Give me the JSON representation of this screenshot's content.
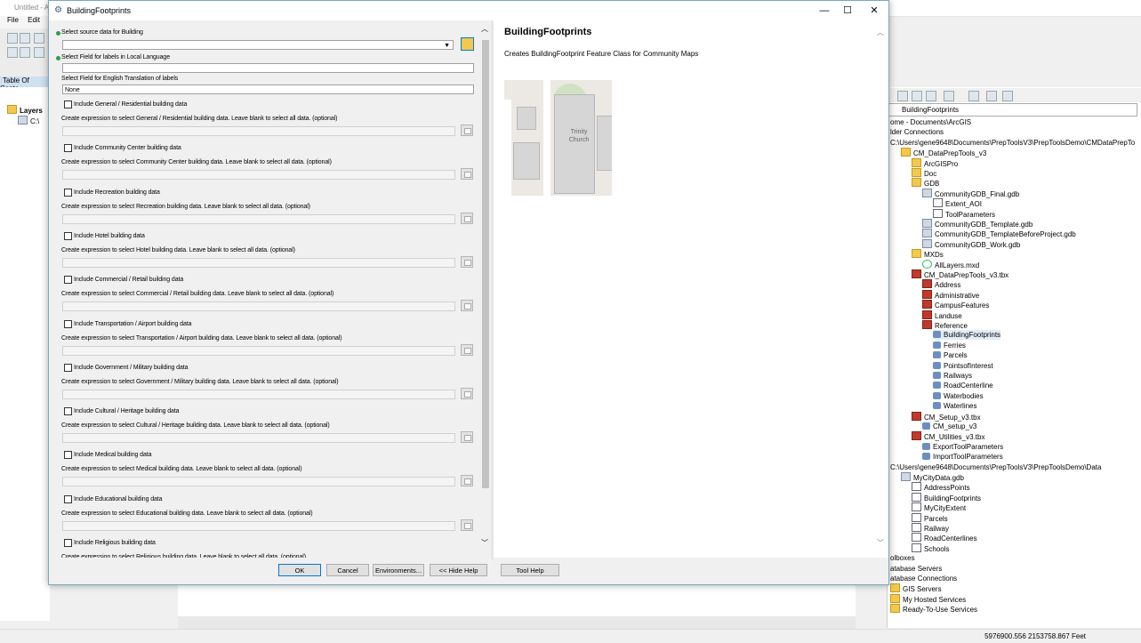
{
  "background_app": {
    "title": "Untitled - A",
    "menu": [
      "File",
      "Edit"
    ],
    "toc_title": "Table Of Conte",
    "toc_layers": "Layers",
    "toc_item": "C:\\",
    "coords": "5976900.556  2153758.867 Feet"
  },
  "catalog": {
    "location": "BuildingFootprints",
    "tree": [
      {
        "text": "ome - Documents\\ArcGIS",
        "level": 0,
        "icon": "none"
      },
      {
        "text": "lder Connections",
        "level": 0,
        "icon": "none"
      },
      {
        "text": "C:\\Users\\gene9648\\Documents\\PrepToolsV3\\PrepToolsDemo\\CMDataPrepTo",
        "level": 0,
        "icon": "none"
      },
      {
        "text": "CM_DataPrepTools_v3",
        "level": 1,
        "icon": "folder"
      },
      {
        "text": "ArcGISPro",
        "level": 2,
        "icon": "folder"
      },
      {
        "text": "Doc",
        "level": 2,
        "icon": "folder"
      },
      {
        "text": "GDB",
        "level": 2,
        "icon": "folder"
      },
      {
        "text": "CommunityGDB_Final.gdb",
        "level": 3,
        "icon": "gdb"
      },
      {
        "text": "Extent_AOI",
        "level": 4,
        "icon": "fc"
      },
      {
        "text": "ToolParameters",
        "level": 4,
        "icon": "fc"
      },
      {
        "text": "CommunityGDB_Template.gdb",
        "level": 3,
        "icon": "gdb"
      },
      {
        "text": "CommunityGDB_TemplateBeforeProject.gdb",
        "level": 3,
        "icon": "gdb"
      },
      {
        "text": "CommunityGDB_Work.gdb",
        "level": 3,
        "icon": "gdb"
      },
      {
        "text": "MXDs",
        "level": 2,
        "icon": "folder"
      },
      {
        "text": "AllLayers.mxd",
        "level": 3,
        "icon": "mxd"
      },
      {
        "text": "CM_DataPrepTools_v3.tbx",
        "level": 2,
        "icon": "tbx"
      },
      {
        "text": "Address",
        "level": 3,
        "icon": "tbx"
      },
      {
        "text": "Administrative",
        "level": 3,
        "icon": "tbx"
      },
      {
        "text": "CampusFeatures",
        "level": 3,
        "icon": "tbx"
      },
      {
        "text": "Landuse",
        "level": 3,
        "icon": "tbx"
      },
      {
        "text": "Reference",
        "level": 3,
        "icon": "tbx"
      },
      {
        "text": "BuildingFootprints",
        "level": 4,
        "icon": "tool",
        "selected": true
      },
      {
        "text": "Ferries",
        "level": 4,
        "icon": "tool"
      },
      {
        "text": "Parcels",
        "level": 4,
        "icon": "tool"
      },
      {
        "text": "PointsofInterest",
        "level": 4,
        "icon": "tool"
      },
      {
        "text": "Railways",
        "level": 4,
        "icon": "tool"
      },
      {
        "text": "RoadCenterline",
        "level": 4,
        "icon": "tool"
      },
      {
        "text": "Waterbodies",
        "level": 4,
        "icon": "tool"
      },
      {
        "text": "Waterlines",
        "level": 4,
        "icon": "tool"
      },
      {
        "text": "CM_Setup_v3.tbx",
        "level": 2,
        "icon": "tbx"
      },
      {
        "text": "CM_setup_v3",
        "level": 3,
        "icon": "tool"
      },
      {
        "text": "CM_Utilities_v3.tbx",
        "level": 2,
        "icon": "tbx"
      },
      {
        "text": "ExportToolParameters",
        "level": 3,
        "icon": "tool"
      },
      {
        "text": "ImportToolParameters",
        "level": 3,
        "icon": "tool"
      },
      {
        "text": "C:\\Users\\gene9648\\Documents\\PrepToolsV3\\PrepToolsDemo\\Data",
        "level": 0,
        "icon": "none"
      },
      {
        "text": "MyCityData.gdb",
        "level": 1,
        "icon": "gdb"
      },
      {
        "text": "AddressPoints",
        "level": 2,
        "icon": "fc"
      },
      {
        "text": "BuildingFootprints",
        "level": 2,
        "icon": "fc"
      },
      {
        "text": "MyCityExtent",
        "level": 2,
        "icon": "fc"
      },
      {
        "text": "Parcels",
        "level": 2,
        "icon": "fc"
      },
      {
        "text": "Railway",
        "level": 2,
        "icon": "fc"
      },
      {
        "text": "RoadCenterlines",
        "level": 2,
        "icon": "fc"
      },
      {
        "text": "Schools",
        "level": 2,
        "icon": "fc"
      },
      {
        "text": "olboxes",
        "level": 0,
        "icon": "none"
      },
      {
        "text": "atabase Servers",
        "level": 0,
        "icon": "none"
      },
      {
        "text": "atabase Connections",
        "level": 0,
        "icon": "none"
      },
      {
        "text": "GIS Servers",
        "level": 0,
        "icon": "folder"
      },
      {
        "text": "My Hosted Services",
        "level": 0,
        "icon": "folder"
      },
      {
        "text": "Ready-To-Use Services",
        "level": 0,
        "icon": "folder"
      }
    ]
  },
  "dialog": {
    "title": "BuildingFootprints",
    "window_buttons": {
      "minimize": "—",
      "maximize": "☐",
      "close": "✕"
    },
    "source_label": "Select source data for Building",
    "local_label": "Select Field for labels in Local Language",
    "english_label": "Select Field for English Translation of labels",
    "english_value": "None",
    "categories": [
      {
        "include": "Include General / Residential building data",
        "expr": "Create expression to select General / Residential building data. Leave blank to select all data. (optional)"
      },
      {
        "include": "Include Community Center building data",
        "expr": "Create expression to select Community Center building data. Leave blank to select all data. (optional)"
      },
      {
        "include": "Include Recreation building data",
        "expr": "Create expression to select Recreation building data. Leave blank to select all data. (optional)"
      },
      {
        "include": "Include Hotel building data",
        "expr": "Create expression to select Hotel building data. Leave blank to select all data. (optional)"
      },
      {
        "include": "Include Commercial / Retail building data",
        "expr": "Create expression to select Commercial / Retail building data. Leave blank to select all data. (optional)"
      },
      {
        "include": "Include Transportation / Airport building data",
        "expr": "Create expression to select Transportation / Airport building data. Leave blank to select all data. (optional)"
      },
      {
        "include": "Include Government / Military building data",
        "expr": "Create expression to select Government / Military building data. Leave blank to select all data. (optional)"
      },
      {
        "include": "Include Cultural / Heritage building data",
        "expr": "Create expression to select Cultural / Heritage building data. Leave blank to select all data. (optional)"
      },
      {
        "include": "Include Medical building data",
        "expr": "Create expression to select Medical building data. Leave blank to select all data. (optional)"
      },
      {
        "include": "Include Educational building data",
        "expr": "Create expression to select Educational building data. Leave blank to select all data. (optional)"
      },
      {
        "include": "Include Religious building data",
        "expr": "Create expression to select Religious building data. Leave blank to select all data. (optional)"
      }
    ],
    "buttons": {
      "ok": "OK",
      "cancel": "Cancel",
      "environments": "Environments...",
      "hide_help": "<< Hide Help",
      "tool_help": "Tool Help"
    },
    "help": {
      "title": "BuildingFootprints",
      "description": "Creates BuildingFootprint Feature Class for Community Maps",
      "map_label_line1": "Trinity",
      "map_label_line2": "Church"
    }
  },
  "colors": {
    "accent": "#0078d7",
    "required_dot": "#2ea043",
    "selection": "#e4ecf7"
  }
}
